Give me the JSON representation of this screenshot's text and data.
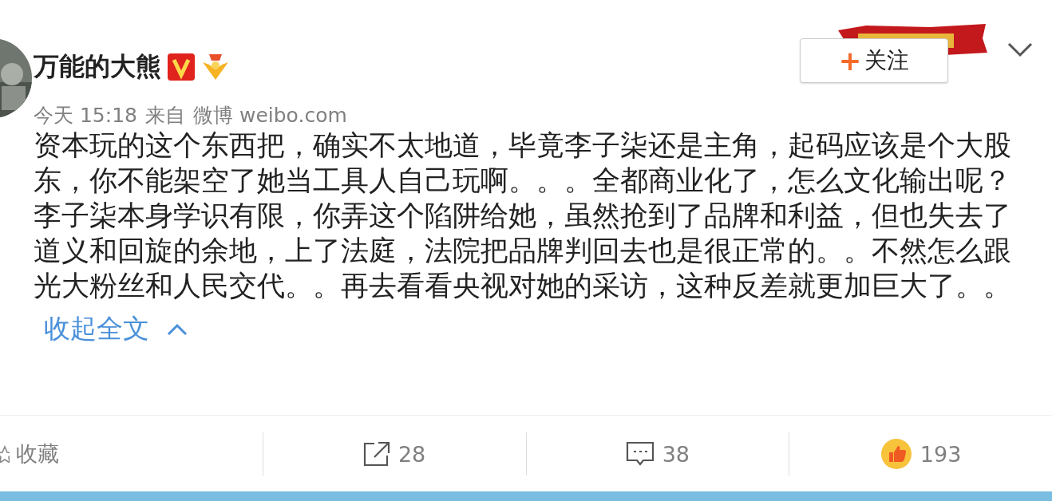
{
  "user": {
    "name": "万能的大熊",
    "verified": true,
    "time": "今天 15:18",
    "source_label": "来自",
    "source": "微博 weibo.com"
  },
  "follow_button": {
    "icon": "+",
    "label": "关注"
  },
  "body": "资本玩的这个东西把，确实不太地道，毕竟李子柒还是主角，起码应该是个大股东，你不能架空了她当工具人自己玩啊。。。全都商业化了，怎么文化输出呢？李子柒本身学识有限，你弄这个陷阱给她，虽然抢到了品牌和利益，但也失去了道义和回旋的余地，上了法庭，法院把品牌判回去也是很正常的。。不然怎么跟光大粉丝和人民交代。。再去看看央视对她的采访，这种反差就更加巨大了。。",
  "collapse_link": "收起全文",
  "actions": [
    {
      "kind": "favorite",
      "label": "收藏"
    },
    {
      "kind": "repost",
      "label": "28"
    },
    {
      "kind": "comment",
      "label": "38"
    },
    {
      "kind": "like",
      "label": "193"
    }
  ]
}
